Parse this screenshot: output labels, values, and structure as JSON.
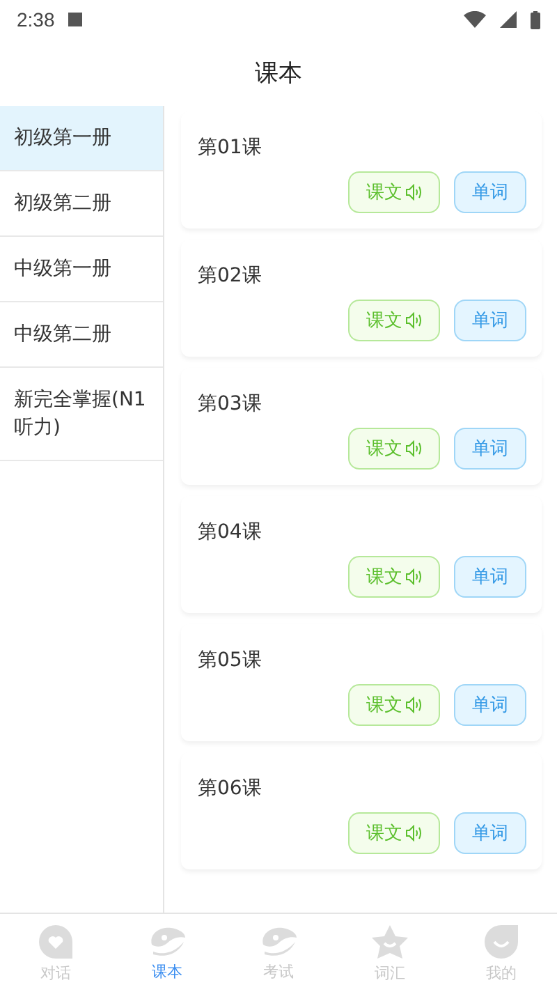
{
  "status_bar": {
    "time": "2:38"
  },
  "header": {
    "title": "课本"
  },
  "sidebar": {
    "items": [
      {
        "label": "初级第一册",
        "selected": true
      },
      {
        "label": "初级第二册",
        "selected": false
      },
      {
        "label": "中级第一册",
        "selected": false
      },
      {
        "label": "中级第二册",
        "selected": false
      },
      {
        "label": "新完全掌握(N1听力)",
        "selected": false
      }
    ]
  },
  "lessons": [
    {
      "title": "第01课",
      "text_button": "课文",
      "words_button": "单词"
    },
    {
      "title": "第02课",
      "text_button": "课文",
      "words_button": "单词"
    },
    {
      "title": "第03课",
      "text_button": "课文",
      "words_button": "单词"
    },
    {
      "title": "第04课",
      "text_button": "课文",
      "words_button": "单词"
    },
    {
      "title": "第05课",
      "text_button": "课文",
      "words_button": "单词"
    },
    {
      "title": "第06课",
      "text_button": "课文",
      "words_button": "单词"
    }
  ],
  "tab_bar": [
    {
      "label": "对话",
      "kind": "heart",
      "selected": false
    },
    {
      "label": "课本",
      "kind": "bubble",
      "selected": true
    },
    {
      "label": "考试",
      "kind": "bubble",
      "selected": false
    },
    {
      "label": "词汇",
      "kind": "star",
      "selected": false
    },
    {
      "label": "我的",
      "kind": "smile",
      "selected": false
    }
  ]
}
